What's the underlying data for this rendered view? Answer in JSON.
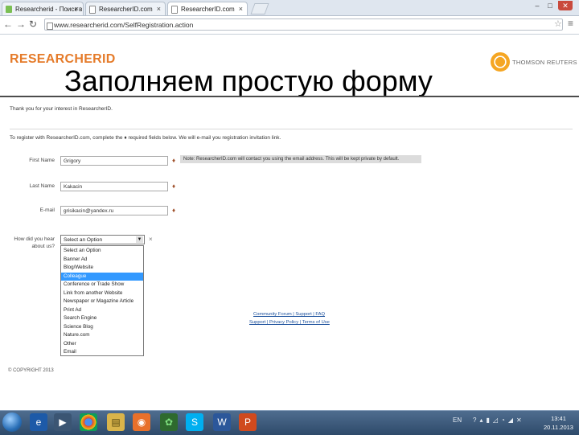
{
  "browser": {
    "tabs": [
      {
        "title": "Researcherid - Поиск в Go"
      },
      {
        "title": "ResearcherID.com"
      },
      {
        "title": "ResearcherID.com"
      }
    ],
    "url": "www.researcherid.com/SelfRegistration.action",
    "window_controls": {
      "minimize": "–",
      "maximize": "□",
      "close": "✕"
    }
  },
  "header": {
    "logo_prefix": "RESEARCHER",
    "logo_suffix": "ID",
    "tr_logo_text": "THOMSON REUTERS",
    "headline": "Заполняем простую форму"
  },
  "form": {
    "thanks": "Thank you for your interest in ResearcherID.",
    "instructions": "To register with ResearcherID.com, complete the ♦ required fields below. We will e-mail you registration invitation link.",
    "required_marker": "♦",
    "first_name_label": "First Name",
    "first_name_value": "Grigory",
    "last_name_label": "Last Name",
    "last_name_value": "Kakacin",
    "email_label": "E-mail",
    "email_value": "grisikacin@yandex.ru",
    "note": "Note: ResearcherID.com will contact you using the email address. This will be kept private by default.",
    "how_label_1": "How did you hear",
    "how_label_2": "about us?",
    "select_value": "Select an Option",
    "select_close": "×",
    "options": [
      "Select an Option",
      "Banner Ad",
      "Blog/Website",
      "Colleague",
      "Conference or Trade Show",
      "Link from another Website",
      "Newspaper or Magazine Article",
      "Print Ad",
      "Search Engine",
      "Science Blog",
      "Nature.com",
      "Other",
      "Email"
    ],
    "selected_option": "Colleague"
  },
  "footer": {
    "links_row1": "Community Forum | Support | FAQ",
    "links_row2": "Support | Privacy Policy | Terms of Use",
    "copyright": "© COPYRIGHT 2013"
  },
  "taskbar": {
    "tray_lang": "EN",
    "clock_time": "13:41",
    "clock_date": "20.11.2013"
  }
}
